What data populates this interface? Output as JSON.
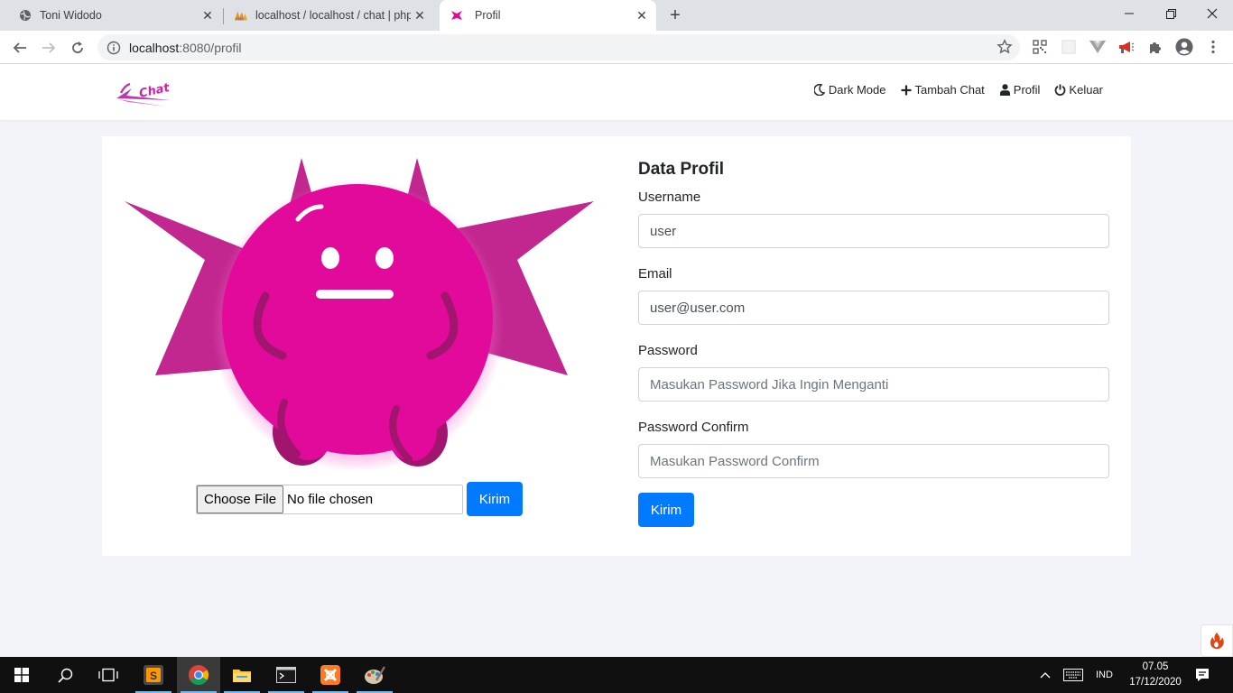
{
  "browser": {
    "tabs": [
      {
        "title": "Toni Widodo",
        "active": false,
        "favicon": "globe-icon"
      },
      {
        "title": "localhost / localhost / chat | phpMyAdmin",
        "active": false,
        "favicon": "phpmyadmin-icon"
      },
      {
        "title": "Profil",
        "active": true,
        "favicon": "site-logo-icon"
      }
    ],
    "url_host": "localhost",
    "url_rest": ":8080/profil",
    "window_controls": [
      "minimize",
      "maximize",
      "close"
    ],
    "extensions": [
      "qr-code-icon",
      "extension-box-icon",
      "vue-devtools-icon",
      "megaphone-icon",
      "puzzle-icon",
      "profile-icon",
      "kebab-menu-icon"
    ]
  },
  "site": {
    "logo_text": "Chat",
    "nav": [
      {
        "label": "Dark Mode",
        "icon": "moon-icon"
      },
      {
        "label": "Tambah Chat",
        "icon": "plus-icon"
      },
      {
        "label": "Profil",
        "icon": "user-icon"
      },
      {
        "label": "Keluar",
        "icon": "power-icon"
      }
    ]
  },
  "avatar_upload": {
    "choose_label": "Choose File",
    "file_status": "No file chosen",
    "submit_label": "Kirim"
  },
  "profile_form": {
    "heading": "Data Profil",
    "username_label": "Username",
    "username_value": "user",
    "email_label": "Email",
    "email_value": "user@user.com",
    "password_label": "Password",
    "password_placeholder": "Masukan Password Jika Ingin Menganti",
    "confirm_label": "Password Confirm",
    "confirm_placeholder": "Masukan Password Confirm",
    "submit_label": "Kirim"
  },
  "taskbar": {
    "apps": [
      "start-icon",
      "search-icon",
      "task-view-icon",
      "sublime-text-icon",
      "chrome-icon",
      "file-explorer-icon",
      "terminal-icon",
      "xampp-icon",
      "paint-icon"
    ],
    "language": "IND",
    "time": "07.05",
    "date": "17/12/2020"
  },
  "colors": {
    "brand_pink": "#e20a9a",
    "star_magenta": "#c1278f",
    "primary_blue": "#007bff"
  }
}
